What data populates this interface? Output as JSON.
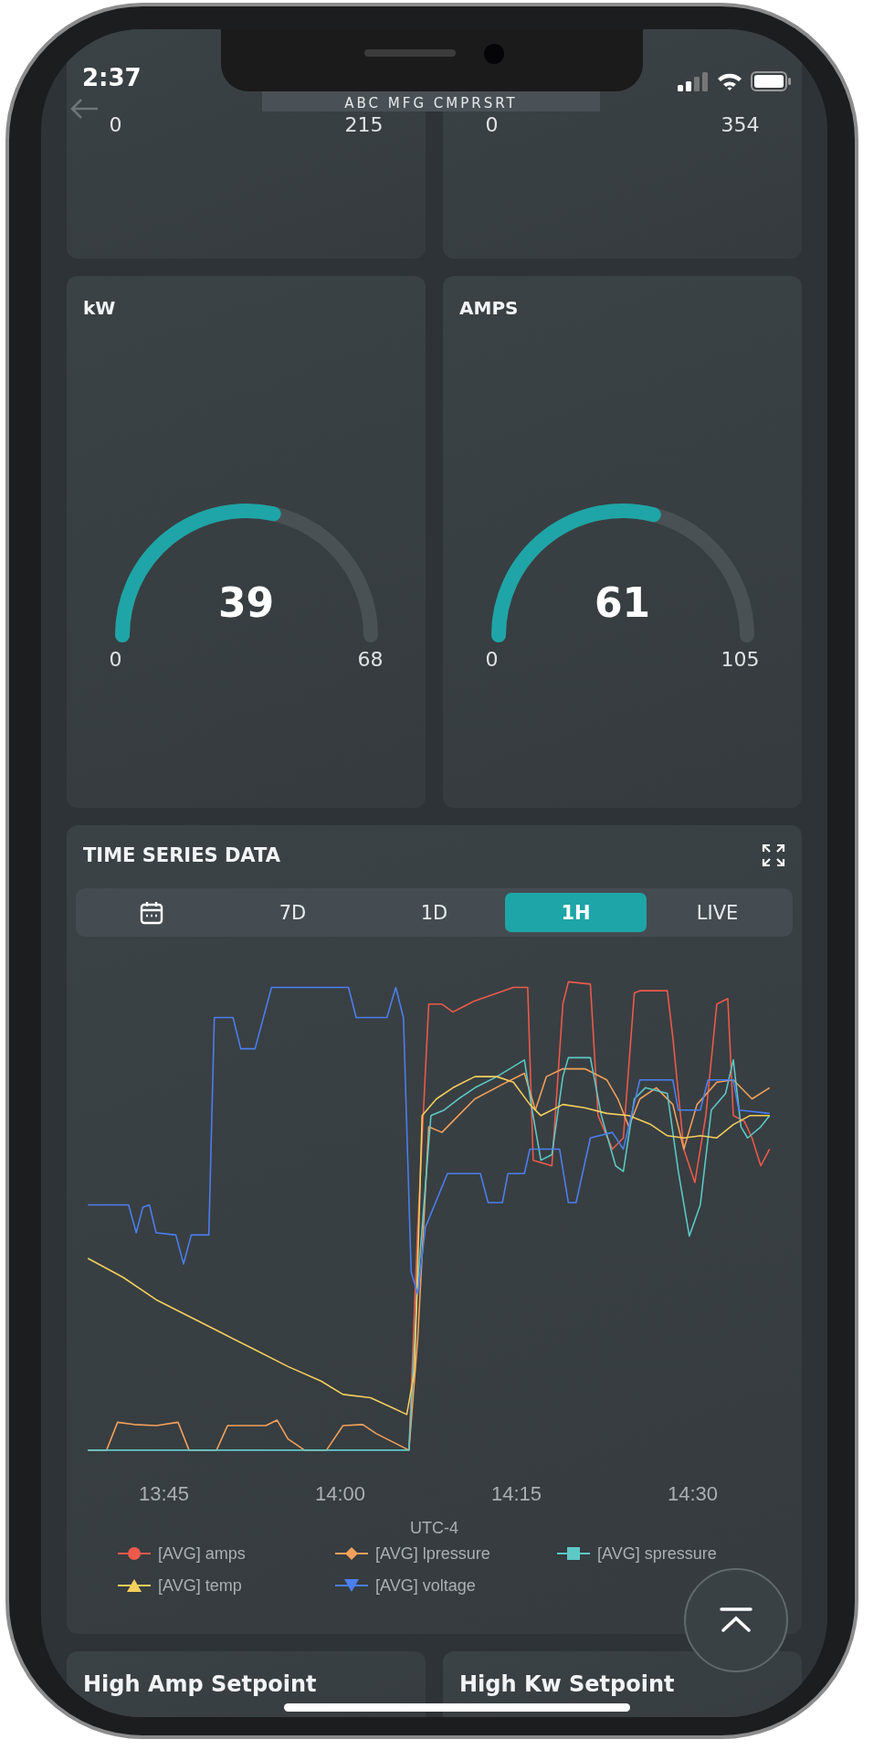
{
  "status_bar": {
    "time": "2:37"
  },
  "header": {
    "title": "ABC MFG CMPRSRT"
  },
  "top_gauges": [
    {
      "min": "0",
      "max": "215"
    },
    {
      "min": "0",
      "max": "354"
    }
  ],
  "gauges": [
    {
      "title": "kW",
      "value": "39",
      "min": "0",
      "max": "68",
      "level": 0.57
    },
    {
      "title": "AMPS",
      "value": "61",
      "min": "0",
      "max": "105",
      "level": 0.58
    }
  ],
  "time_series": {
    "title": "TIME SERIES DATA",
    "ranges": [
      {
        "kind": "calendar",
        "selected": false
      },
      {
        "kind": "text",
        "label": "7D",
        "selected": false
      },
      {
        "kind": "text",
        "label": "1D",
        "selected": false
      },
      {
        "kind": "text",
        "label": "1H",
        "selected": true
      },
      {
        "kind": "text",
        "label": "LIVE",
        "selected": false
      }
    ],
    "xticks": [
      "13:45",
      "14:00",
      "14:15",
      "14:30"
    ],
    "timezone": "UTC-4",
    "legend": [
      {
        "label": "[AVG] amps",
        "kind": "circle",
        "color": "#ec5a4c"
      },
      {
        "label": "[AVG] lpressure",
        "kind": "diamond",
        "color": "#f4a05c"
      },
      {
        "label": "[AVG] spressure",
        "kind": "square",
        "color": "#5ec8c6"
      },
      {
        "label": "[AVG] temp",
        "kind": "triangle",
        "color": "#f5cf5e"
      },
      {
        "label": "[AVG] voltage",
        "kind": "triangle-down",
        "color": "#4b7ff0"
      }
    ]
  },
  "setpoints": [
    {
      "title": "High Amp Setpoint"
    },
    {
      "title": "High Kw Setpoint"
    }
  ]
}
